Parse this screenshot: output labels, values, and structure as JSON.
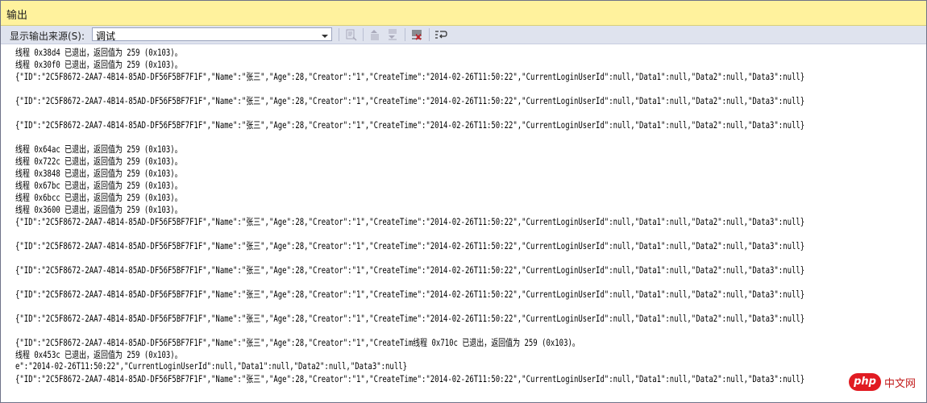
{
  "window": {
    "title": "输出"
  },
  "toolbar": {
    "source_label": "显示输出来源(S):",
    "source_value": "调试",
    "buttons": [
      {
        "name": "find-in-file-icon",
        "enabled": false
      },
      {
        "name": "prev-message-icon",
        "enabled": false
      },
      {
        "name": "next-message-icon",
        "enabled": false
      },
      {
        "name": "clear-all-icon",
        "enabled": true
      },
      {
        "name": "word-wrap-icon",
        "enabled": true
      }
    ]
  },
  "output_lines": [
    {
      "text": "线程 0x38d4 已退出，返回值为 259 (0x103)。"
    },
    {
      "text": "线程 0x30f0 已退出，返回值为 259 (0x103)。"
    },
    {
      "text": "{\"ID\":\"2C5F8672-2AA7-4B14-85AD-DF56F5BF7F1F\",\"Name\":\"张三\",\"Age\":28,\"Creator\":\"1\",\"CreateTime\":\"2014-02-26T11:50:22\",\"CurrentLoginUserId\":null,\"Data1\":null,\"Data2\":null,\"Data3\":null}"
    },
    {
      "text": ""
    },
    {
      "text": "{\"ID\":\"2C5F8672-2AA7-4B14-85AD-DF56F5BF7F1F\",\"Name\":\"张三\",\"Age\":28,\"Creator\":\"1\",\"CreateTime\":\"2014-02-26T11:50:22\",\"CurrentLoginUserId\":null,\"Data1\":null,\"Data2\":null,\"Data3\":null}"
    },
    {
      "text": ""
    },
    {
      "text": "{\"ID\":\"2C5F8672-2AA7-4B14-85AD-DF56F5BF7F1F\",\"Name\":\"张三\",\"Age\":28,\"Creator\":\"1\",\"CreateTime\":\"2014-02-26T11:50:22\",\"CurrentLoginUserId\":null,\"Data1\":null,\"Data2\":null,\"Data3\":null}"
    },
    {
      "text": ""
    },
    {
      "text": "线程 0x64ac 已退出，返回值为 259 (0x103)。"
    },
    {
      "text": "线程 0x722c 已退出，返回值为 259 (0x103)。"
    },
    {
      "text": "线程 0x3848 已退出，返回值为 259 (0x103)。"
    },
    {
      "text": "线程 0x67bc 已退出，返回值为 259 (0x103)。"
    },
    {
      "text": "线程 0x6bcc 已退出，返回值为 259 (0x103)。"
    },
    {
      "text": "线程 0x3600 已退出，返回值为 259 (0x103)。"
    },
    {
      "text": "{\"ID\":\"2C5F8672-2AA7-4B14-85AD-DF56F5BF7F1F\",\"Name\":\"张三\",\"Age\":28,\"Creator\":\"1\",\"CreateTime\":\"2014-02-26T11:50:22\",\"CurrentLoginUserId\":null,\"Data1\":null,\"Data2\":null,\"Data3\":null}"
    },
    {
      "text": ""
    },
    {
      "text": "{\"ID\":\"2C5F8672-2AA7-4B14-85AD-DF56F5BF7F1F\",\"Name\":\"张三\",\"Age\":28,\"Creator\":\"1\",\"CreateTime\":\"2014-02-26T11:50:22\",\"CurrentLoginUserId\":null,\"Data1\":null,\"Data2\":null,\"Data3\":null}"
    },
    {
      "text": ""
    },
    {
      "text": "{\"ID\":\"2C5F8672-2AA7-4B14-85AD-DF56F5BF7F1F\",\"Name\":\"张三\",\"Age\":28,\"Creator\":\"1\",\"CreateTime\":\"2014-02-26T11:50:22\",\"CurrentLoginUserId\":null,\"Data1\":null,\"Data2\":null,\"Data3\":null}"
    },
    {
      "text": ""
    },
    {
      "text": "{\"ID\":\"2C5F8672-2AA7-4B14-85AD-DF56F5BF7F1F\",\"Name\":\"张三\",\"Age\":28,\"Creator\":\"1\",\"CreateTime\":\"2014-02-26T11:50:22\",\"CurrentLoginUserId\":null,\"Data1\":null,\"Data2\":null,\"Data3\":null}"
    },
    {
      "text": ""
    },
    {
      "text": "{\"ID\":\"2C5F8672-2AA7-4B14-85AD-DF56F5BF7F1F\",\"Name\":\"张三\",\"Age\":28,\"Creator\":\"1\",\"CreateTime\":\"2014-02-26T11:50:22\",\"CurrentLoginUserId\":null,\"Data1\":null,\"Data2\":null,\"Data3\":null}"
    },
    {
      "text": ""
    },
    {
      "text": "{\"ID\":\"2C5F8672-2AA7-4B14-85AD-DF56F5BF7F1F\",\"Name\":\"张三\",\"Age\":28,\"Creator\":\"1\",\"CreateTim线程 0x710c 已退出，返回值为 259 (0x103)。"
    },
    {
      "text": "线程 0x453c 已退出，返回值为 259 (0x103)。"
    },
    {
      "text": "e\":\"2014-02-26T11:50:22\",\"CurrentLoginUserId\":null,\"Data1\":null,\"Data2\":null,\"Data3\":null}"
    },
    {
      "text": "{\"ID\":\"2C5F8672-2AA7-4B14-85AD-DF56F5BF7F1F\",\"Name\":\"张三\",\"Age\":28,\"Creator\":\"1\",\"CreateTime\":\"2014-02-26T11:50:22\",\"CurrentLoginUserId\":null,\"Data1\":null,\"Data2\":null,\"Data3\":null}"
    }
  ],
  "watermark": {
    "brand": "php",
    "site": "中文网"
  },
  "colors": {
    "title_bg": "#fff29d",
    "toolbar_bg": "#dfe3ee",
    "clear_icon": "#c0262d"
  }
}
